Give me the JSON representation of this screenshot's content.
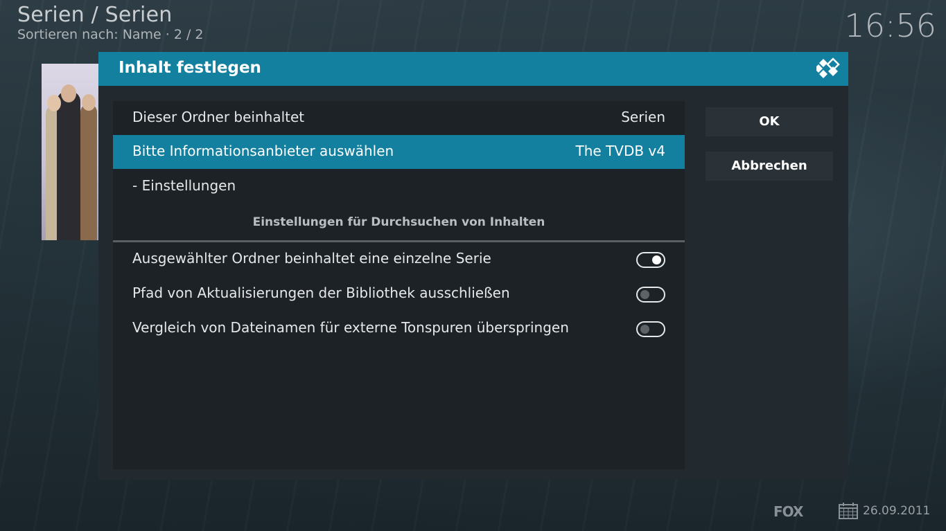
{
  "header": {
    "title": "Serien / Serien",
    "subtitle": "Sortieren nach: Name  ·  2 / 2",
    "clock": "16:56"
  },
  "dialog": {
    "title": "Inhalt festlegen",
    "rows": [
      {
        "label": "Dieser Ordner beinhaltet",
        "value": "Serien"
      },
      {
        "label": "Bitte Informationsanbieter auswählen",
        "value": "The TVDB v4"
      },
      {
        "label": "- Einstellungen"
      }
    ],
    "section_heading": "Einstellungen für Durchsuchen von Inhalten",
    "toggles": [
      {
        "label": "Ausgewählter Ordner beinhaltet eine einzelne Serie",
        "state": "on"
      },
      {
        "label": "Pfad von Aktualisierungen der Bibliothek ausschließen",
        "state": "off"
      },
      {
        "label": "Vergleich von Dateinamen für externe Tonspuren überspringen",
        "state": "off"
      }
    ],
    "buttons": {
      "ok": "OK",
      "cancel": "Abbrechen"
    }
  },
  "footer": {
    "network": "FOX",
    "date": "26.09.2011"
  },
  "colors": {
    "accent": "#13809f",
    "dialog_bg": "#222a2f",
    "panel_bg": "#1c2226",
    "button_bg": "#2b3237"
  },
  "icons": [
    "kodi-logo-icon",
    "calendar-icon"
  ]
}
